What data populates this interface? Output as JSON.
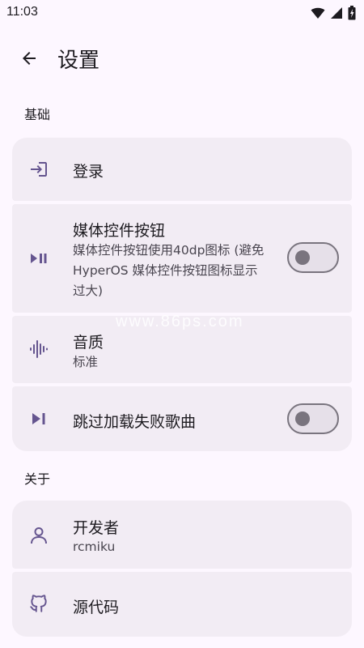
{
  "status_bar": {
    "time": "11:03"
  },
  "top_bar": {
    "title": "设置"
  },
  "sections": {
    "basic": "基础",
    "about": "关于"
  },
  "items": {
    "login": {
      "title": "登录",
      "icon": "login-icon"
    },
    "media_controls": {
      "title": "媒体控件按钮",
      "subtitle": "媒体控件按钮使用40dp图标 (避免HyperOS 媒体控件按钮图标显示过大)",
      "subtitle_lines": [
        "媒体控件按钮使用40dp图标 (避免",
        "HyperOS 媒体控件按钮图标显示",
        "过大)"
      ],
      "toggle": false,
      "icon": "play-pause-icon"
    },
    "audio_quality": {
      "title": "音质",
      "subtitle": "标准",
      "icon": "waveform-icon"
    },
    "skip_failed": {
      "title": "跳过加载失败歌曲",
      "toggle": false,
      "icon": "skip-next-icon"
    },
    "developer": {
      "title": "开发者",
      "subtitle": "rcmiku",
      "icon": "person-icon"
    },
    "source_code": {
      "title": "源代码",
      "icon": "github-icon"
    }
  },
  "watermark": "www.86ps.com",
  "colors": {
    "background": "#fdf7ff",
    "card": "#f2ecf4",
    "icon_accent": "#65558f",
    "switch_outline": "#79747e"
  }
}
